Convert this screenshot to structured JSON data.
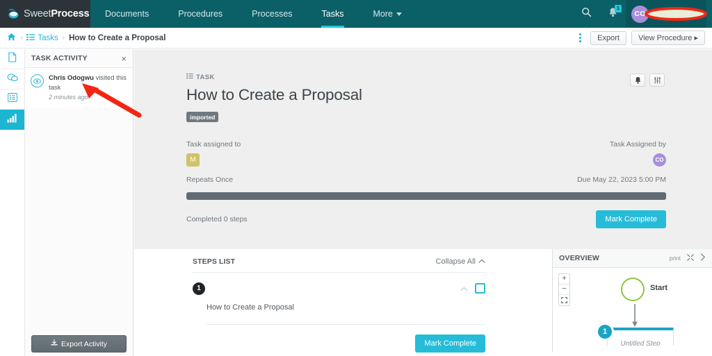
{
  "brand": {
    "name_light": "Sweet",
    "name_bold": "Process",
    "accent": "#24c4de",
    "header_bg": "#0b6067",
    "logo_bg": "#2c3439"
  },
  "topnav": {
    "tabs": [
      {
        "label": "Documents",
        "active": false
      },
      {
        "label": "Procedures",
        "active": false
      },
      {
        "label": "Processes",
        "active": false
      },
      {
        "label": "Tasks",
        "active": true
      },
      {
        "label": "More",
        "active": false,
        "has_caret": true
      }
    ],
    "search_icon": "search-icon",
    "notifications_icon": "bell-icon",
    "notifications_count": "1",
    "user": {
      "initials": "CO",
      "name": ""
    }
  },
  "breadcrumb": {
    "home_icon": "home-icon",
    "items": [
      {
        "label": "Tasks",
        "link": true
      },
      {
        "label": "How to Create a Proposal",
        "link": false
      }
    ],
    "separator": "›",
    "kebab_label": "more-options",
    "export_label": "Export",
    "view_procedure_label": "View Procedure ▸"
  },
  "rail": {
    "items": [
      {
        "name": "documents-icon",
        "active": false
      },
      {
        "name": "comments-icon",
        "active": false
      },
      {
        "name": "checklist-icon",
        "active": false
      },
      {
        "name": "activity-chart-icon",
        "active": true
      }
    ],
    "active_bg": "#1cb5d2"
  },
  "activity_panel": {
    "title": "TASK ACTIVITY",
    "close_label": "×",
    "entries": [
      {
        "icon": "eye-icon",
        "actor": "Chris Odogwu",
        "action": "visited this task",
        "time": "2 minutes ago"
      }
    ],
    "export_button": "Export Activity",
    "export_icon": "download-icon"
  },
  "task": {
    "eyebrow": "TASK",
    "eyebrow_icon": "list-icon",
    "title": "How to Create a Proposal",
    "tag": "imported",
    "tools": [
      {
        "name": "bell-icon"
      },
      {
        "name": "sliders-icon"
      }
    ],
    "assigned_to_label": "Task assigned to",
    "assigned_to_initial": "M",
    "assigned_to_color": "#cfc26a",
    "assigned_by_label": "Task Assigned by",
    "assigned_by_initials": "CO",
    "assigned_by_color": "#a98fd8",
    "repeats": "Repeats Once",
    "due": "Due May 22, 2023 5:00 PM",
    "progress_percent": 0,
    "progress_color": "#616b73",
    "completed_text": "Completed 0 steps",
    "mark_complete_label": "Mark Complete",
    "mark_complete_color": "#26bcd8"
  },
  "steps": {
    "title": "STEPS LIST",
    "collapse_all_label": "Collapse All",
    "collapse_icon": "chevron-up-icon",
    "items": [
      {
        "number": "1",
        "title": "How to Create a Proposal",
        "checked": false
      }
    ],
    "mark_complete_label": "Mark Complete"
  },
  "overview": {
    "title": "OVERVIEW",
    "print_label": "print",
    "expand_icon": "expand-icon",
    "next_icon": "chevron-right-icon",
    "zoom_in": "+",
    "zoom_out": "−",
    "zoom_fit": "fit-icon",
    "start_label": "Start",
    "start_border_color": "#8cc63f",
    "node_number": "1",
    "node_label": "Untitled Step",
    "node_accent": "#1ba5c4"
  },
  "annotations": {
    "oval_color": "#f22613",
    "arrow_color": "#f22613",
    "oval_target": "username",
    "arrow_target": "activity-timestamp"
  }
}
